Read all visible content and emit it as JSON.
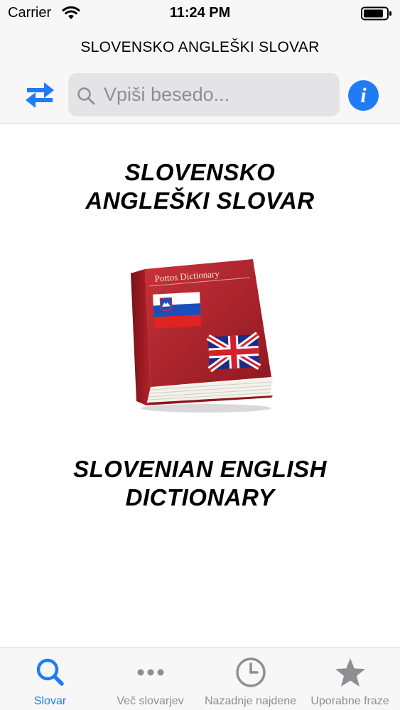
{
  "status_bar": {
    "carrier": "Carrier",
    "time": "11:24 PM"
  },
  "nav": {
    "title": "SLOVENSKO ANGLEŠKI SLOVAR"
  },
  "search": {
    "placeholder": "Vpiši besedo...",
    "value": ""
  },
  "info_button": {
    "label": "i"
  },
  "main": {
    "heading_top_line1": "SLOVENSKO",
    "heading_top_line2": "ANGLEŠKI SLOVAR",
    "book_title": "Pottos Dictionary",
    "heading_bottom_line1": "SLOVENIAN ENGLISH",
    "heading_bottom_line2": "DICTIONARY"
  },
  "tabs": [
    {
      "label": "Slovar",
      "icon": "search-icon",
      "active": true
    },
    {
      "label": "Več slovarjev",
      "icon": "more-dots-icon",
      "active": false
    },
    {
      "label": "Nazadnje najdene",
      "icon": "clock-icon",
      "active": false
    },
    {
      "label": "Uporabne fraze",
      "icon": "star-icon",
      "active": false
    }
  ],
  "colors": {
    "accent": "#1f7cf5",
    "tab_inactive": "#8e8e93",
    "bar_background": "#f7f7f7",
    "book_red": "#b3222b"
  }
}
